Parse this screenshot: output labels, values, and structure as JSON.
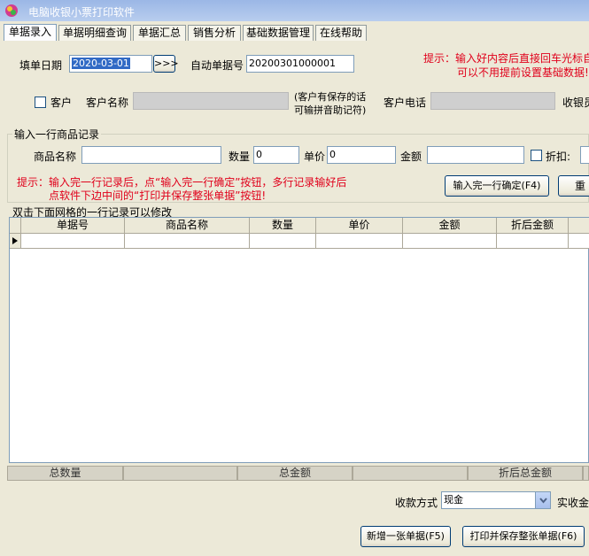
{
  "window": {
    "title": "电脑收银小票打印软件"
  },
  "tabs": [
    {
      "label": "单据录入"
    },
    {
      "label": "单据明细查询"
    },
    {
      "label": "单据汇总"
    },
    {
      "label": "销售分析"
    },
    {
      "label": "基础数据管理"
    },
    {
      "label": "在线帮助"
    }
  ],
  "header": {
    "date_label": "填单日期",
    "date_value": "2020-03-01",
    "date_button": ">>>",
    "auto_no_label": "自动单据号",
    "auto_no_value": "20200301000001",
    "tip_line1": "提示：输入好内容后直接回车光标自",
    "tip_line2": "可以不用提前设置基础数据!",
    "customer_check_label": "客户",
    "customer_name_label": "客户名称",
    "customer_note_line1": "(客户有保存的话",
    "customer_note_line2": "可输拼音助记符)",
    "customer_phone_label": "客户电话",
    "cashier_label": "收银员"
  },
  "entry": {
    "group_title": "输入一行商品记录",
    "product_label": "商品名称",
    "qty_label": "数量",
    "qty_value": "0",
    "price_label": "单价",
    "price_value": "0",
    "amount_label": "金额",
    "discount_label": "折扣:",
    "tip_line1": "提示：输入完一行记录后，点“输入完一行确定”按钮，多行记录输好后",
    "tip_line2": "点软件下边中间的“打印并保存整张单据”按钮!",
    "confirm_button": "输入完一行确定(F4)",
    "redo_button": "重"
  },
  "grid": {
    "caption": "双击下面网格的一行记录可以修改",
    "columns": [
      "单据号",
      "商品名称",
      "数量",
      "单价",
      "金额",
      "折后金额"
    ]
  },
  "totals": {
    "qty": "总数量",
    "amount": "总金额",
    "discounted": "折后总金额"
  },
  "payment": {
    "method_label": "收款方式",
    "method_value": "现金",
    "received_label": "实收金"
  },
  "actions": {
    "new_button": "新增一张单据(F5)",
    "print_button": "打印并保存整张单据(F6)"
  }
}
